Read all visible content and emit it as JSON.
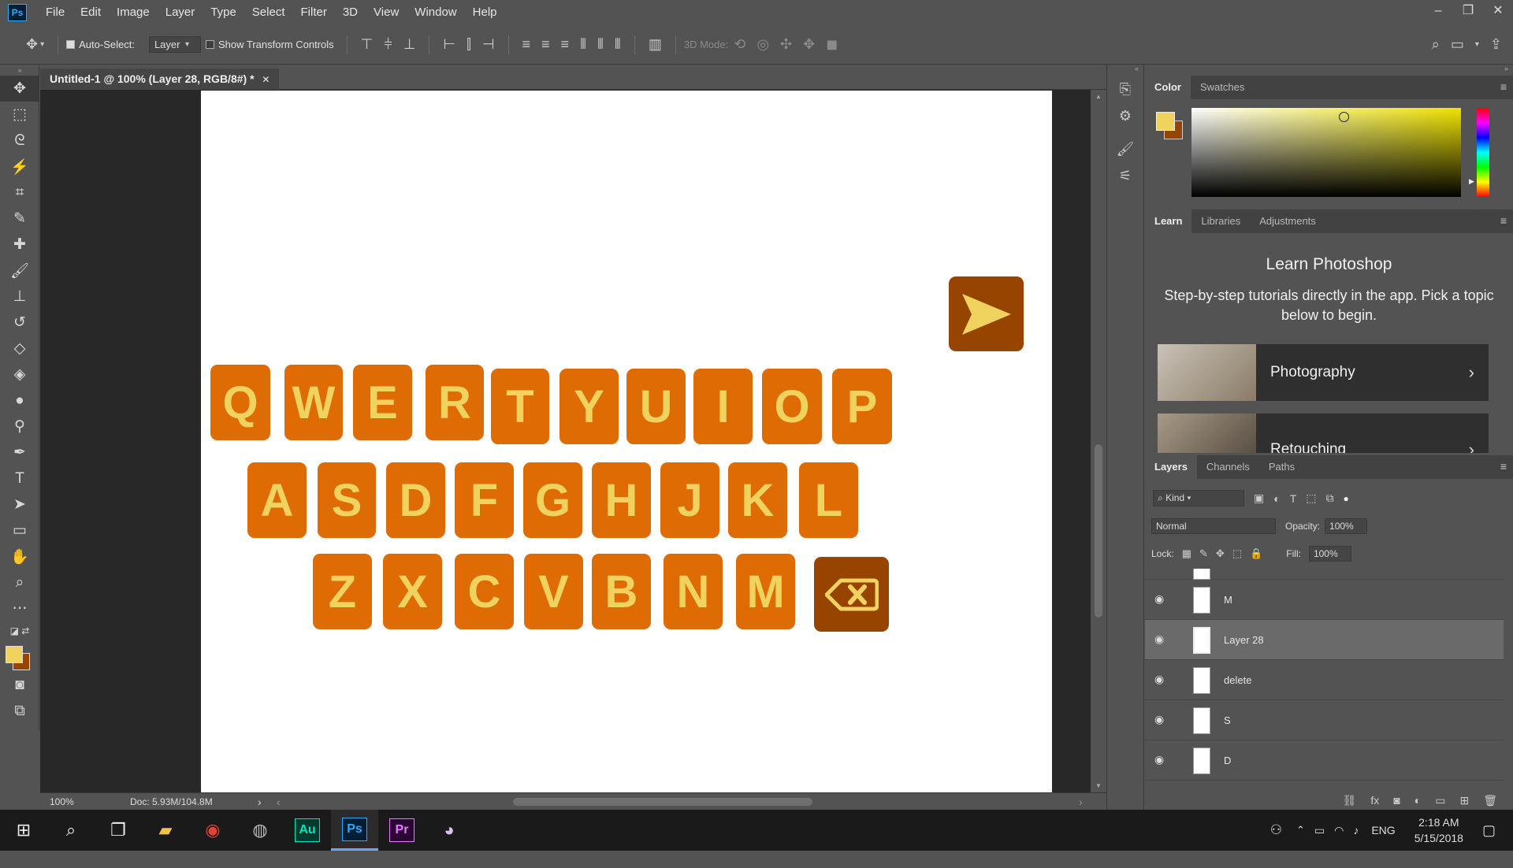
{
  "app": {
    "logo": "Ps"
  },
  "menu": [
    "File",
    "Edit",
    "Image",
    "Layer",
    "Type",
    "Select",
    "Filter",
    "3D",
    "View",
    "Window",
    "Help"
  ],
  "window_controls": {
    "minimize": "–",
    "restore": "❐",
    "close": "✕"
  },
  "options": {
    "auto_select_label": "Auto-Select:",
    "auto_select_target": "Layer",
    "show_transform_label": "Show Transform Controls",
    "mode_3d_label": "3D Mode:"
  },
  "document": {
    "tab_title": "Untitled-1 @ 100% (Layer 28, RGB/8#) *",
    "close": "✕"
  },
  "status": {
    "zoom": "100%",
    "doc": "Doc: 5.93M/104.8M",
    "arrow": "›",
    "left": "‹",
    "right": "›"
  },
  "keyboard": {
    "key_color": "#df6b04",
    "dark_key_color": "#974401",
    "letter_color": "#f0d35e",
    "send_icon": "send-arrow-icon",
    "backspace_icon": "backspace-icon",
    "row1": [
      "Q",
      "W",
      "E",
      "R",
      "T",
      "Y",
      "U",
      "I",
      "O",
      "P"
    ],
    "row2": [
      "A",
      "S",
      "D",
      "F",
      "G",
      "H",
      "J",
      "K",
      "L"
    ],
    "row3": [
      "Z",
      "X",
      "C",
      "V",
      "B",
      "N",
      "M"
    ]
  },
  "color_panel": {
    "tabs": [
      "Color",
      "Swatches"
    ],
    "foreground": "#f0d35e",
    "background": "#974401"
  },
  "learn_panel": {
    "tabs": [
      "Learn",
      "Libraries",
      "Adjustments"
    ],
    "title": "Learn Photoshop",
    "description": "Step-by-step tutorials directly in the app. Pick a topic below to begin.",
    "cards": [
      "Photography",
      "Retouching"
    ]
  },
  "layers_panel": {
    "tabs": [
      "Layers",
      "Channels",
      "Paths"
    ],
    "kind": "Kind",
    "blend_mode": "Normal",
    "opacity_label": "Opacity:",
    "opacity": "100%",
    "lock_label": "Lock:",
    "fill_label": "Fill:",
    "fill": "100%",
    "layers": [
      "M",
      "Layer 28",
      "delete",
      "S",
      "D"
    ],
    "selected": "Layer 28"
  },
  "taskbar": {
    "apps": [
      "Au",
      "Ps",
      "Pr"
    ],
    "language": "ENG",
    "time": "2:18 AM",
    "date": "5/15/2018"
  }
}
